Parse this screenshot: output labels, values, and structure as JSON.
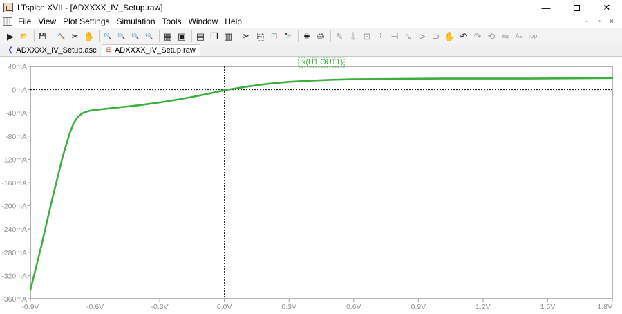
{
  "window": {
    "title": "LTspice XVII - [ADXXXX_IV_Setup.raw]",
    "controls": {
      "minimize": "—",
      "close": "✕"
    }
  },
  "menu": {
    "items": [
      {
        "label": "File"
      },
      {
        "label": "View"
      },
      {
        "label": "Plot Settings"
      },
      {
        "label": "Simulation"
      },
      {
        "label": "Tools"
      },
      {
        "label": "Window"
      },
      {
        "label": "Help"
      }
    ],
    "mdi_controls": [
      "-",
      "▫",
      "×"
    ]
  },
  "toolbar": {
    "buttons": [
      {
        "icon": "run-icon",
        "glyph": "▶"
      },
      {
        "icon": "open-icon",
        "glyph": "📂"
      },
      {
        "sep": true
      },
      {
        "icon": "save-icon",
        "glyph": "💾"
      },
      {
        "sep": true
      },
      {
        "icon": "control-panel-icon",
        "glyph": "🔨"
      },
      {
        "icon": "halt-icon",
        "glyph": "✂"
      },
      {
        "icon": "pan-icon",
        "glyph": "✋"
      },
      {
        "sep": true
      },
      {
        "icon": "zoom-in-icon",
        "glyph": "🔍"
      },
      {
        "icon": "zoom-out-icon",
        "glyph": "🔍"
      },
      {
        "icon": "zoom-fit-icon",
        "glyph": "🔍"
      },
      {
        "icon": "zoom-cancel-icon",
        "glyph": "🔍"
      },
      {
        "sep": true
      },
      {
        "icon": "autorange-icon",
        "glyph": "▦"
      },
      {
        "icon": "marker-icon",
        "glyph": "▣"
      },
      {
        "sep": true
      },
      {
        "icon": "tile-horizontal-icon",
        "glyph": "▤"
      },
      {
        "icon": "cascade-icon",
        "glyph": "❐"
      },
      {
        "icon": "tile-vertical-icon",
        "glyph": "▥"
      },
      {
        "sep": true
      },
      {
        "icon": "cut-icon",
        "glyph": "✂"
      },
      {
        "icon": "copy-icon",
        "glyph": "⎘"
      },
      {
        "icon": "paste-icon",
        "glyph": "📋"
      },
      {
        "icon": "find-icon",
        "glyph": "🔭"
      },
      {
        "sep": true
      },
      {
        "icon": "print-icon",
        "glyph": "🖶"
      },
      {
        "icon": "print-setup-icon",
        "glyph": "🖨"
      },
      {
        "sep": true
      },
      {
        "icon": "wire-icon",
        "glyph": "✎",
        "dim": true
      },
      {
        "icon": "ground-icon",
        "glyph": "⏚",
        "dim": true
      },
      {
        "icon": "label-net-icon",
        "glyph": "⊡",
        "dim": true
      },
      {
        "icon": "resistor-icon",
        "glyph": "⌇",
        "dim": true
      },
      {
        "icon": "capacitor-icon",
        "glyph": "⊣",
        "dim": true
      },
      {
        "icon": "inductor-icon",
        "glyph": "∿",
        "dim": true
      },
      {
        "icon": "diode-icon",
        "glyph": "⊳",
        "dim": true
      },
      {
        "icon": "component-icon",
        "glyph": "⊃",
        "dim": true
      },
      {
        "icon": "drag-icon",
        "glyph": "✋",
        "dim": true
      },
      {
        "icon": "undo-icon",
        "glyph": "↶"
      },
      {
        "icon": "redo-icon",
        "glyph": "↷",
        "dim": true
      },
      {
        "icon": "rotate-icon",
        "glyph": "⟲",
        "dim": true
      },
      {
        "icon": "mirror-icon",
        "glyph": "⇋",
        "dim": true
      },
      {
        "icon": "text-icon",
        "glyph": "Aa",
        "dim": true
      },
      {
        "icon": "spice-directive-icon",
        "glyph": ".op",
        "dim": true
      }
    ]
  },
  "tabs": [
    {
      "label": "ADXXXX_IV_Setup.asc",
      "icon": "schematic-icon",
      "active": false
    },
    {
      "label": "ADXXXX_IV_Setup.raw",
      "icon": "waveform-icon",
      "active": true
    }
  ],
  "colors": {
    "trace": "#3daf3d",
    "plot_border": "#9a9a9a",
    "axis_text": "#8f8f8f",
    "zero_lines": "#000000"
  },
  "chart_data": {
    "type": "line",
    "title": "",
    "trace_label": "Ix(U1:OUT1)",
    "xlabel": "",
    "ylabel": "",
    "xlim": [
      -0.9,
      1.8
    ],
    "ylim": [
      -360,
      40
    ],
    "x_ticks": [
      {
        "v": -0.9,
        "label": "-0.9V"
      },
      {
        "v": -0.6,
        "label": "-0.6V"
      },
      {
        "v": -0.3,
        "label": "-0.3V"
      },
      {
        "v": 0.0,
        "label": "0.0V"
      },
      {
        "v": 0.3,
        "label": "0.3V"
      },
      {
        "v": 0.6,
        "label": "0.6V"
      },
      {
        "v": 0.9,
        "label": "0.9V"
      },
      {
        "v": 1.2,
        "label": "1.2V"
      },
      {
        "v": 1.5,
        "label": "1.5V"
      },
      {
        "v": 1.8,
        "label": "1.8V"
      }
    ],
    "y_ticks": [
      {
        "v": 40,
        "label": "40mA"
      },
      {
        "v": 0,
        "label": "0mA"
      },
      {
        "v": -40,
        "label": "-40mA"
      },
      {
        "v": -80,
        "label": "-80mA"
      },
      {
        "v": -120,
        "label": "-120mA"
      },
      {
        "v": -160,
        "label": "-160mA"
      },
      {
        "v": -200,
        "label": "-200mA"
      },
      {
        "v": -240,
        "label": "-240mA"
      },
      {
        "v": -280,
        "label": "-280mA"
      },
      {
        "v": -320,
        "label": "-320mA"
      },
      {
        "v": -360,
        "label": "-360mA"
      }
    ],
    "series": [
      {
        "name": "Ix(U1:OUT1)",
        "x": [
          -0.9,
          -0.85,
          -0.8,
          -0.75,
          -0.72,
          -0.7,
          -0.68,
          -0.66,
          -0.64,
          -0.62,
          -0.6,
          -0.55,
          -0.5,
          -0.45,
          -0.4,
          -0.35,
          -0.3,
          -0.25,
          -0.2,
          -0.15,
          -0.1,
          -0.05,
          0.0,
          0.05,
          0.1,
          0.15,
          0.2,
          0.3,
          0.4,
          0.5,
          0.6,
          0.8,
          1.0,
          1.2,
          1.4,
          1.6,
          1.8
        ],
        "y": [
          -345,
          -270,
          -190,
          -115,
          -78,
          -58,
          -47,
          -41,
          -38,
          -36,
          -35,
          -33,
          -31,
          -29,
          -27,
          -24.5,
          -22,
          -19,
          -16,
          -12.5,
          -9,
          -5,
          -1,
          2,
          5,
          7.5,
          10,
          13.5,
          15.5,
          17,
          18,
          18.5,
          19,
          19,
          19,
          19.5,
          20
        ]
      }
    ],
    "zero_lines": {
      "x": 0,
      "y": 0
    },
    "grid": false,
    "legend": "top-center"
  }
}
